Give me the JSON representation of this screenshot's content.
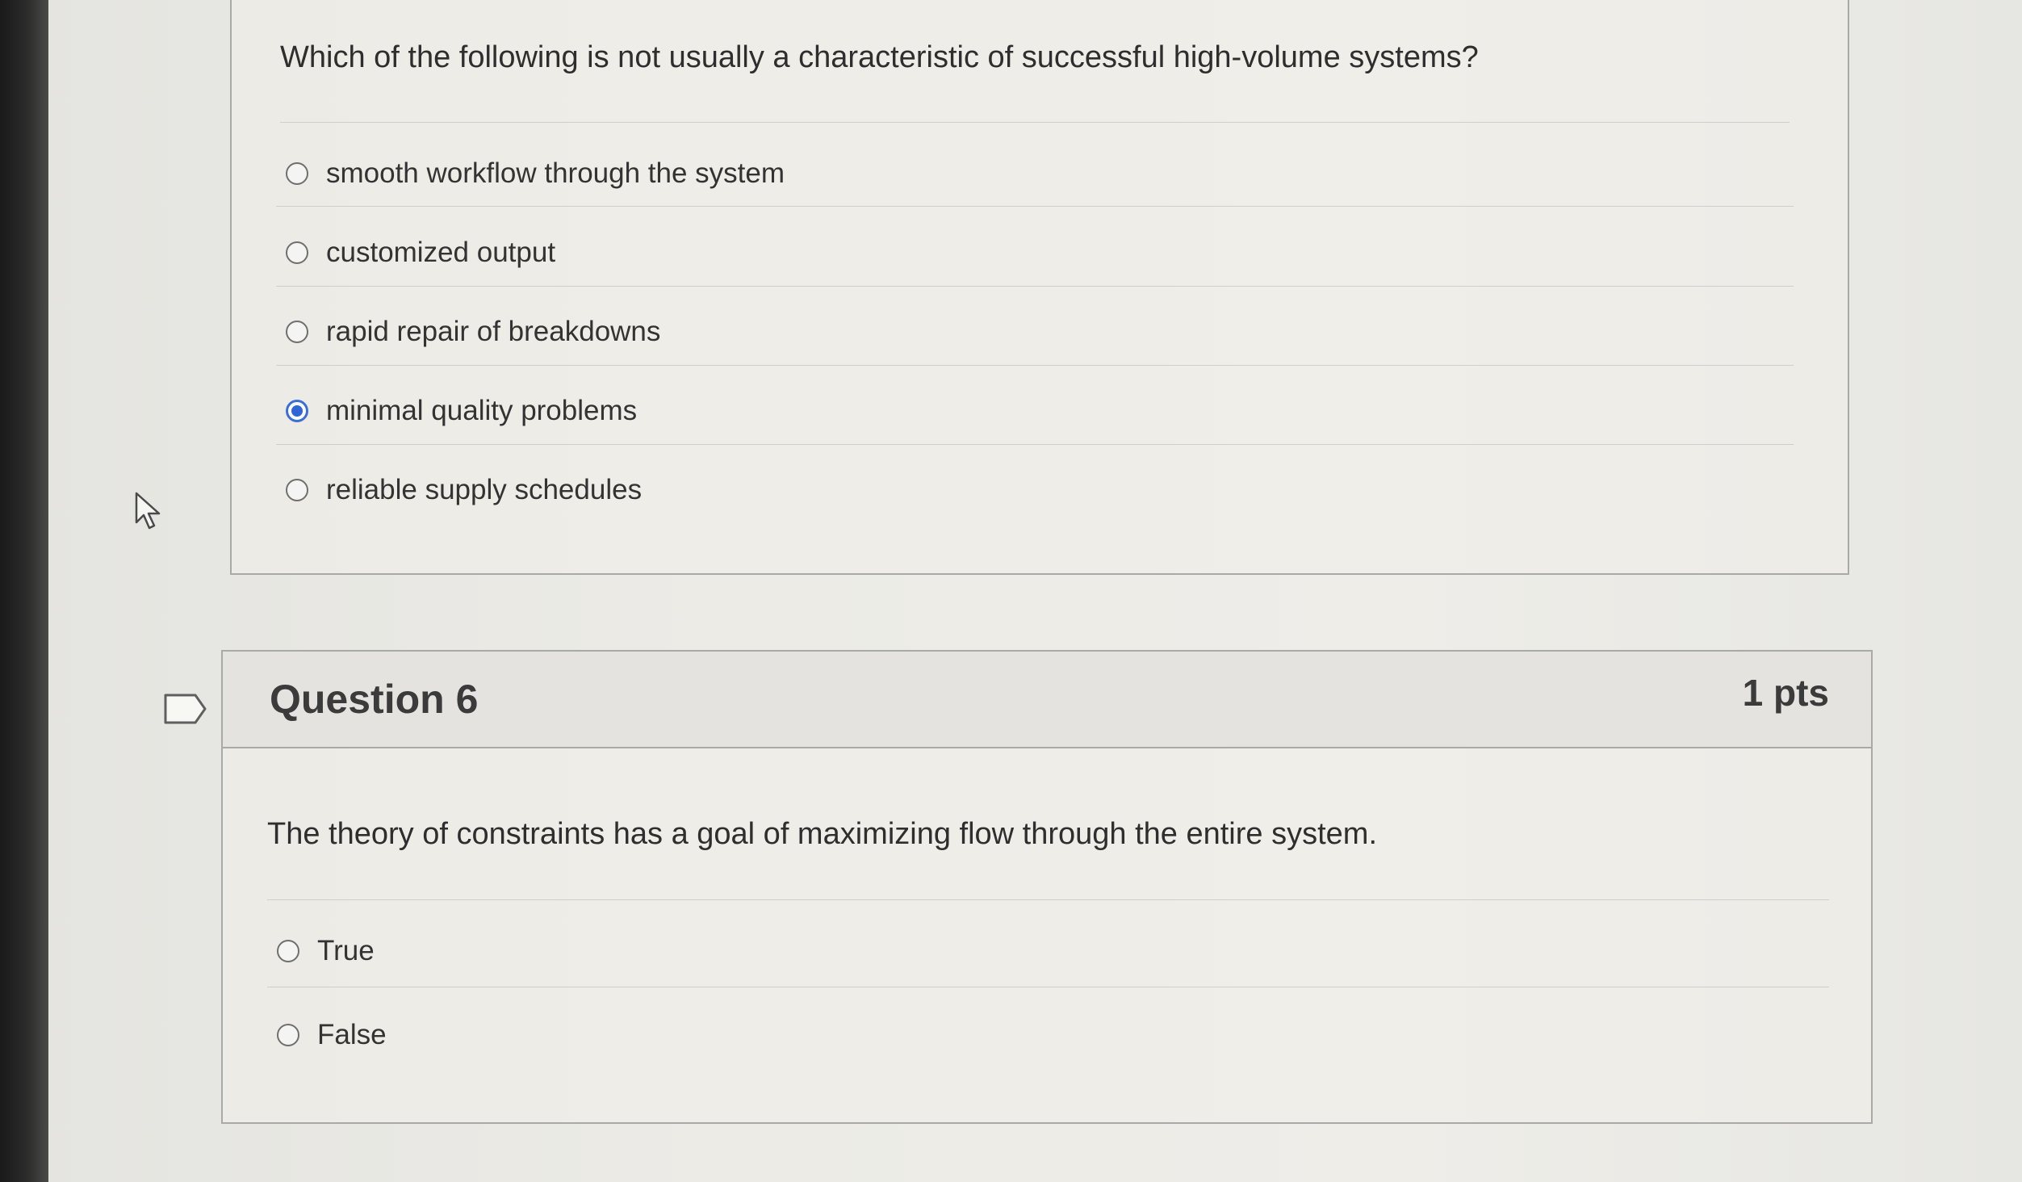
{
  "question5": {
    "text": "Which of the following is not usually a characteristic of successful high-volume systems?",
    "answers": [
      {
        "label": "smooth workflow through the system",
        "selected": false
      },
      {
        "label": "customized output",
        "selected": false
      },
      {
        "label": "rapid repair of breakdowns",
        "selected": false
      },
      {
        "label": "minimal quality problems",
        "selected": true
      },
      {
        "label": "reliable supply schedules",
        "selected": false
      }
    ]
  },
  "question6": {
    "title": "Question 6",
    "points": "1 pts",
    "text": "The theory of constraints has a goal of maximizing flow through the entire system.",
    "answers": [
      {
        "label": "True",
        "selected": false
      },
      {
        "label": "False",
        "selected": false
      }
    ]
  },
  "icons": {
    "bookmark": "bookmark-flag-icon",
    "pointer": "mouse-pointer-icon"
  },
  "colors": {
    "radio_selected": "#2f66d6",
    "card_border": "#a9a9a6",
    "header_background": "#e4e3df"
  }
}
